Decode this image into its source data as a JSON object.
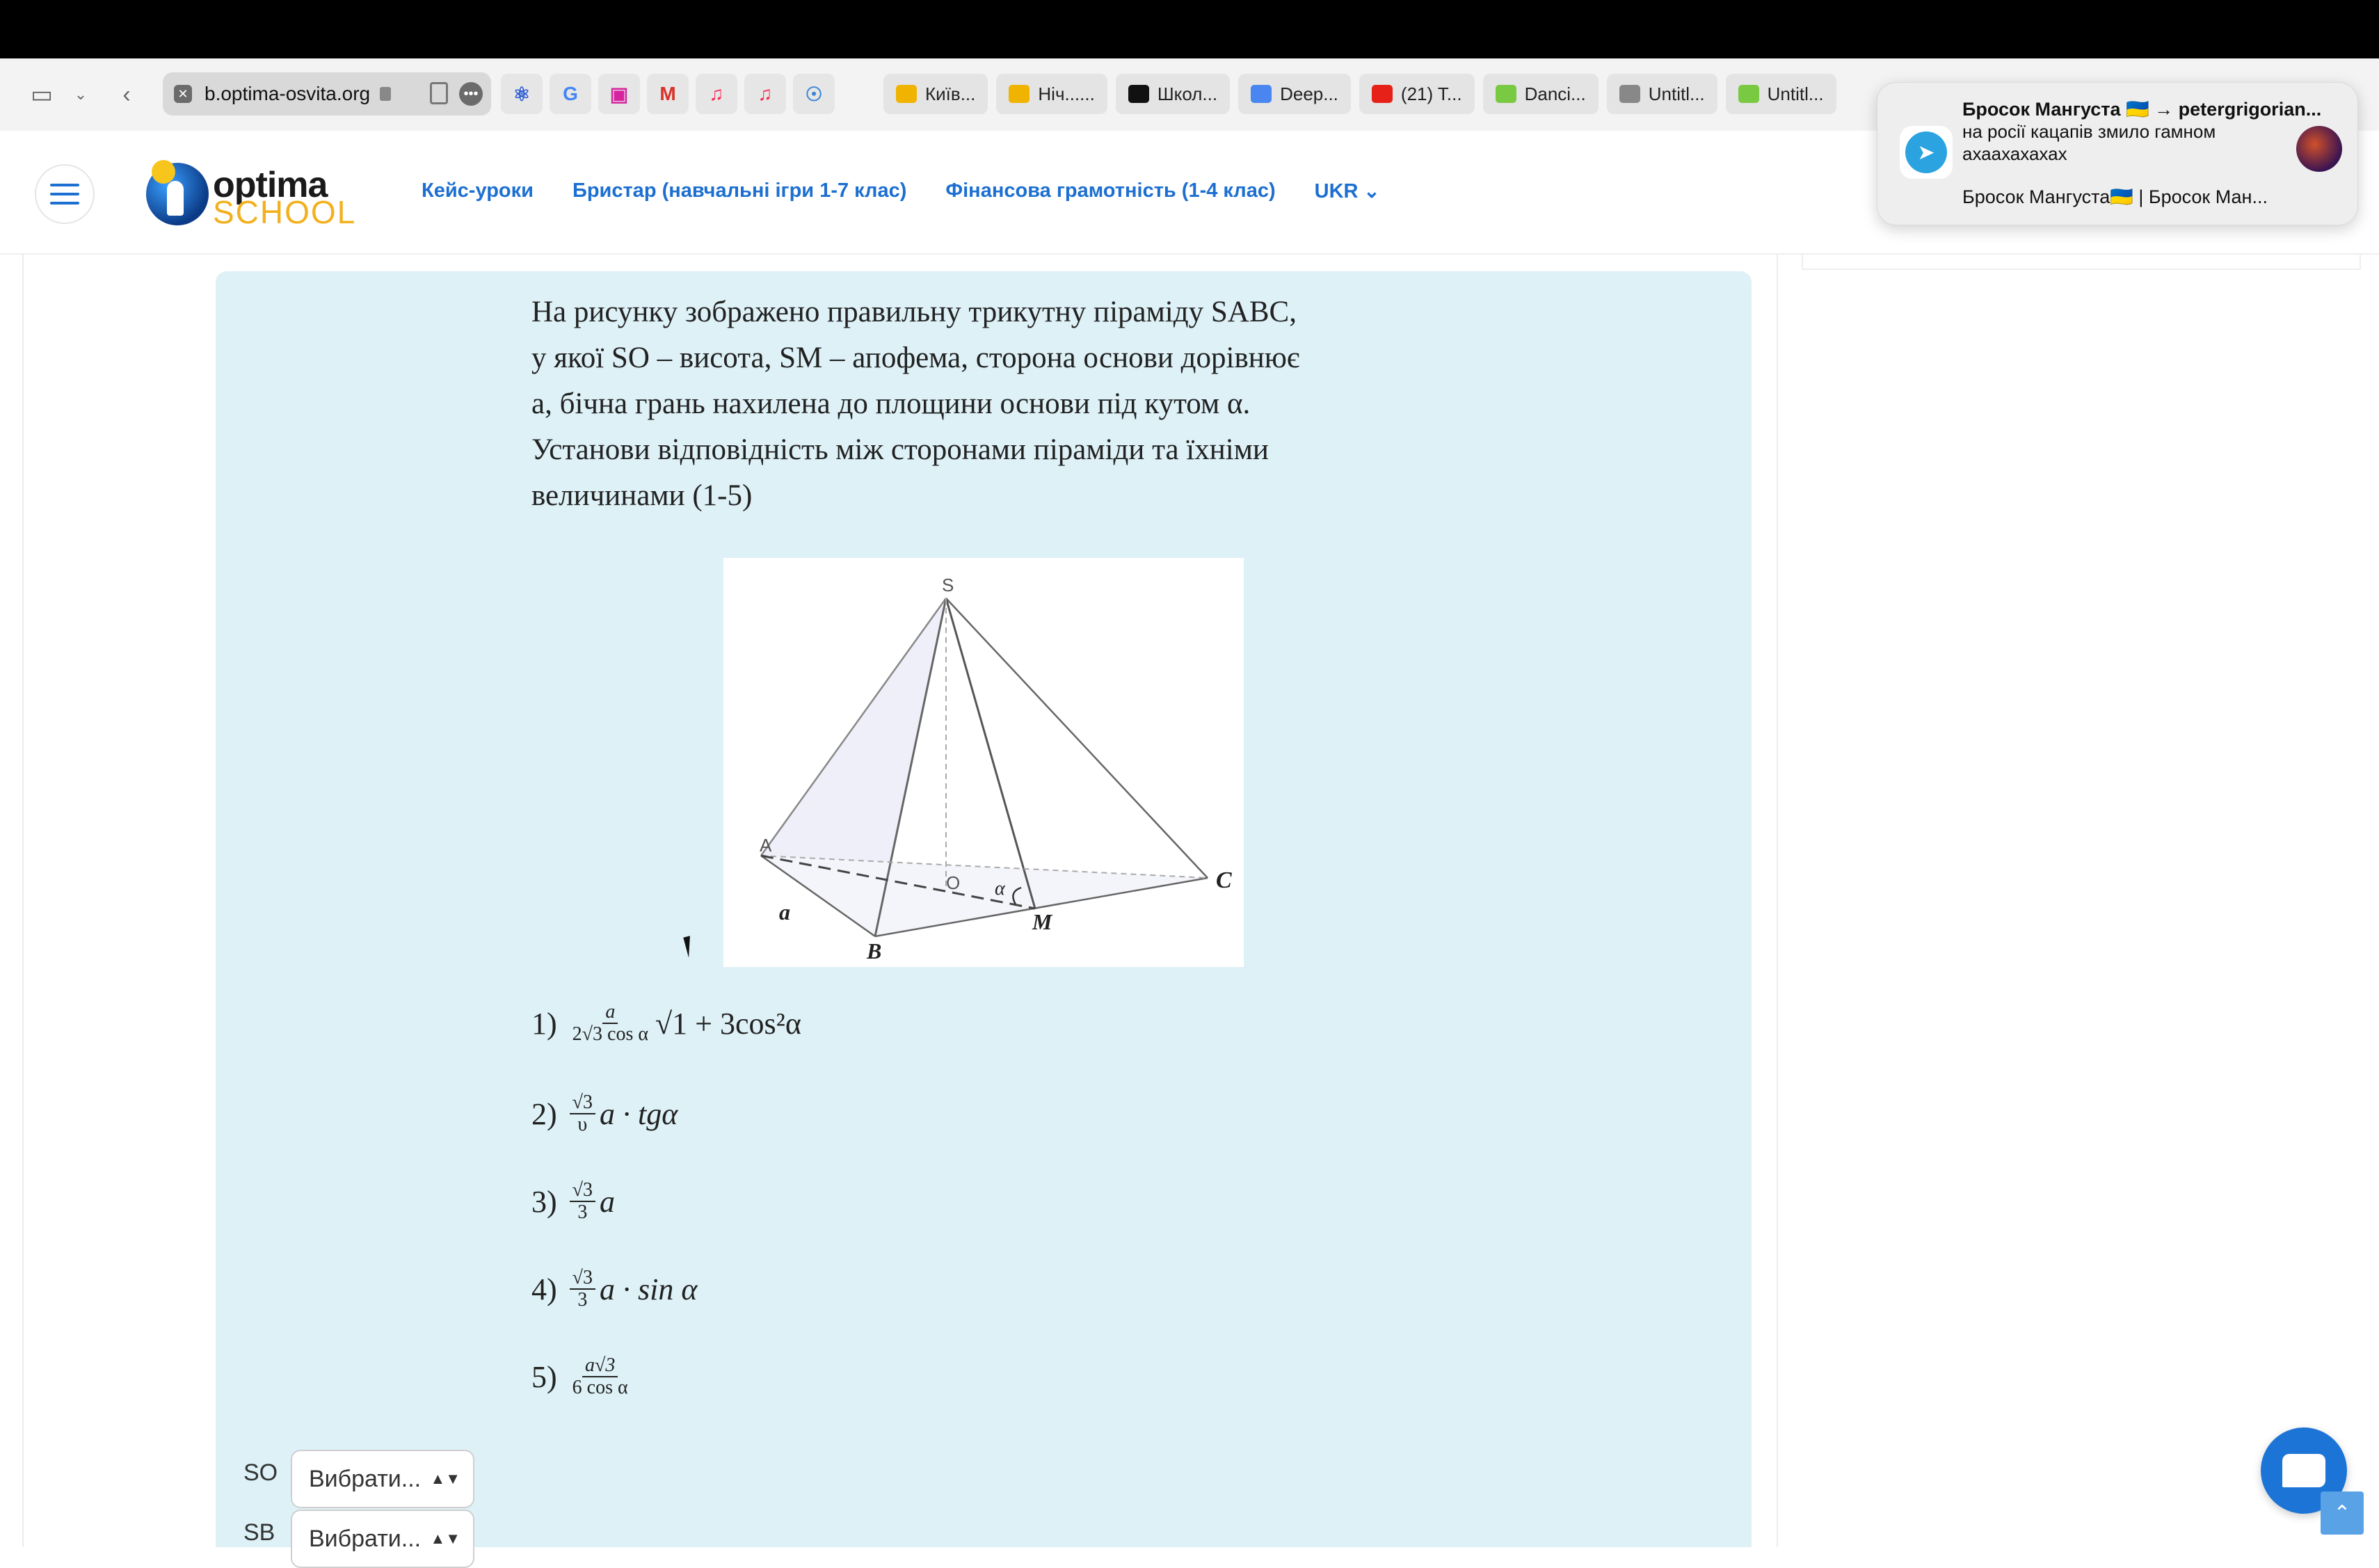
{
  "browser": {
    "url": "b.optima-osvita.org",
    "tabs": [
      {
        "label": "Київ...",
        "color": "#f0b400"
      },
      {
        "label": "Ніч......",
        "color": "#f0b400"
      },
      {
        "label": "Школ...",
        "color": "#111111"
      },
      {
        "label": "Deep...",
        "color": "#4a86f0"
      },
      {
        "label": "(21) T...",
        "color": "#e62117"
      },
      {
        "label": "Danci...",
        "color": "#7ac943"
      },
      {
        "label": "Untitl...",
        "color": "#888888"
      },
      {
        "label": "Untitl...",
        "color": "#7ac943"
      }
    ]
  },
  "site": {
    "logo_top": "optima",
    "logo_bottom": "SCHOOL",
    "nav": [
      "Кейс-уроки",
      "Бристар (навчальні ігри 1-7 клас)",
      "Фінансова грамотність (1-4 клас)",
      "UKR"
    ]
  },
  "question": {
    "lines": [
      "На рисунку зображено правильну трикутну піраміду SABC,",
      "у якої SO – висота, SM – апофема, сторона основи дорівнює",
      "a, бічна грань нахилена до площини основи під кутом α.",
      "Установи відповідність між сторонами піраміди та їхніми",
      "величинами (1-5)"
    ]
  },
  "figure": {
    "labels": {
      "S": "S",
      "A": "A",
      "B": "B",
      "C": "C",
      "O": "O",
      "M": "M",
      "a": "a",
      "alpha": "α"
    }
  },
  "answers": [
    {
      "num": "1)",
      "frac_top": "a",
      "frac_bot": "2√3 cos α",
      "rest": "√1 + 3cos²α"
    },
    {
      "num": "2)",
      "frac_top": "√3",
      "frac_bot": "υ",
      "rest": "a · tgα"
    },
    {
      "num": "3)",
      "frac_top": "√3",
      "frac_bot": "3",
      "rest": "a"
    },
    {
      "num": "4)",
      "frac_top": "√3",
      "frac_bot": "3",
      "rest": "a · sin α"
    },
    {
      "num": "5)",
      "frac_top": "a√3",
      "frac_bot": "6 cos α",
      "rest": ""
    }
  ],
  "selects": [
    {
      "label": "SO",
      "value": "Вибрати..."
    },
    {
      "label": "SB",
      "value": "Вибрати..."
    }
  ],
  "notification": {
    "title": "Бросок Мангуста 🇺🇦 → petergrigorian...",
    "message": "на росії кацапів змило гамном ахаахахахах",
    "footer": "Бросок Мангуста🇺🇦 | Бросок Ман..."
  }
}
